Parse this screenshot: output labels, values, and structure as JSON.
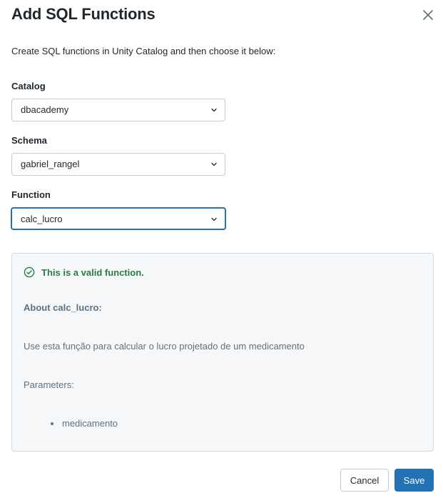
{
  "dialog": {
    "title": "Add SQL Functions",
    "description": "Create SQL functions in Unity Catalog and then choose it below:"
  },
  "fields": {
    "catalog": {
      "label": "Catalog",
      "value": "dbacademy"
    },
    "schema": {
      "label": "Schema",
      "value": "gabriel_rangel"
    },
    "function": {
      "label": "Function",
      "value": "calc_lucro"
    }
  },
  "info": {
    "status": "This is a valid function.",
    "about": "About calc_lucro:",
    "description": "Use esta função para calcular o lucro projetado de um medicamento",
    "parameters_label": "Parameters:",
    "parameters": [
      "medicamento"
    ]
  },
  "footer": {
    "cancel_label": "Cancel",
    "save_label": "Save"
  },
  "icons": {
    "close": "close-icon",
    "chevron": "chevron-down-icon",
    "check": "check-circle-icon"
  },
  "colors": {
    "primary": "#2272b4",
    "success": "#277c43",
    "muted_text": "#5f7281"
  }
}
